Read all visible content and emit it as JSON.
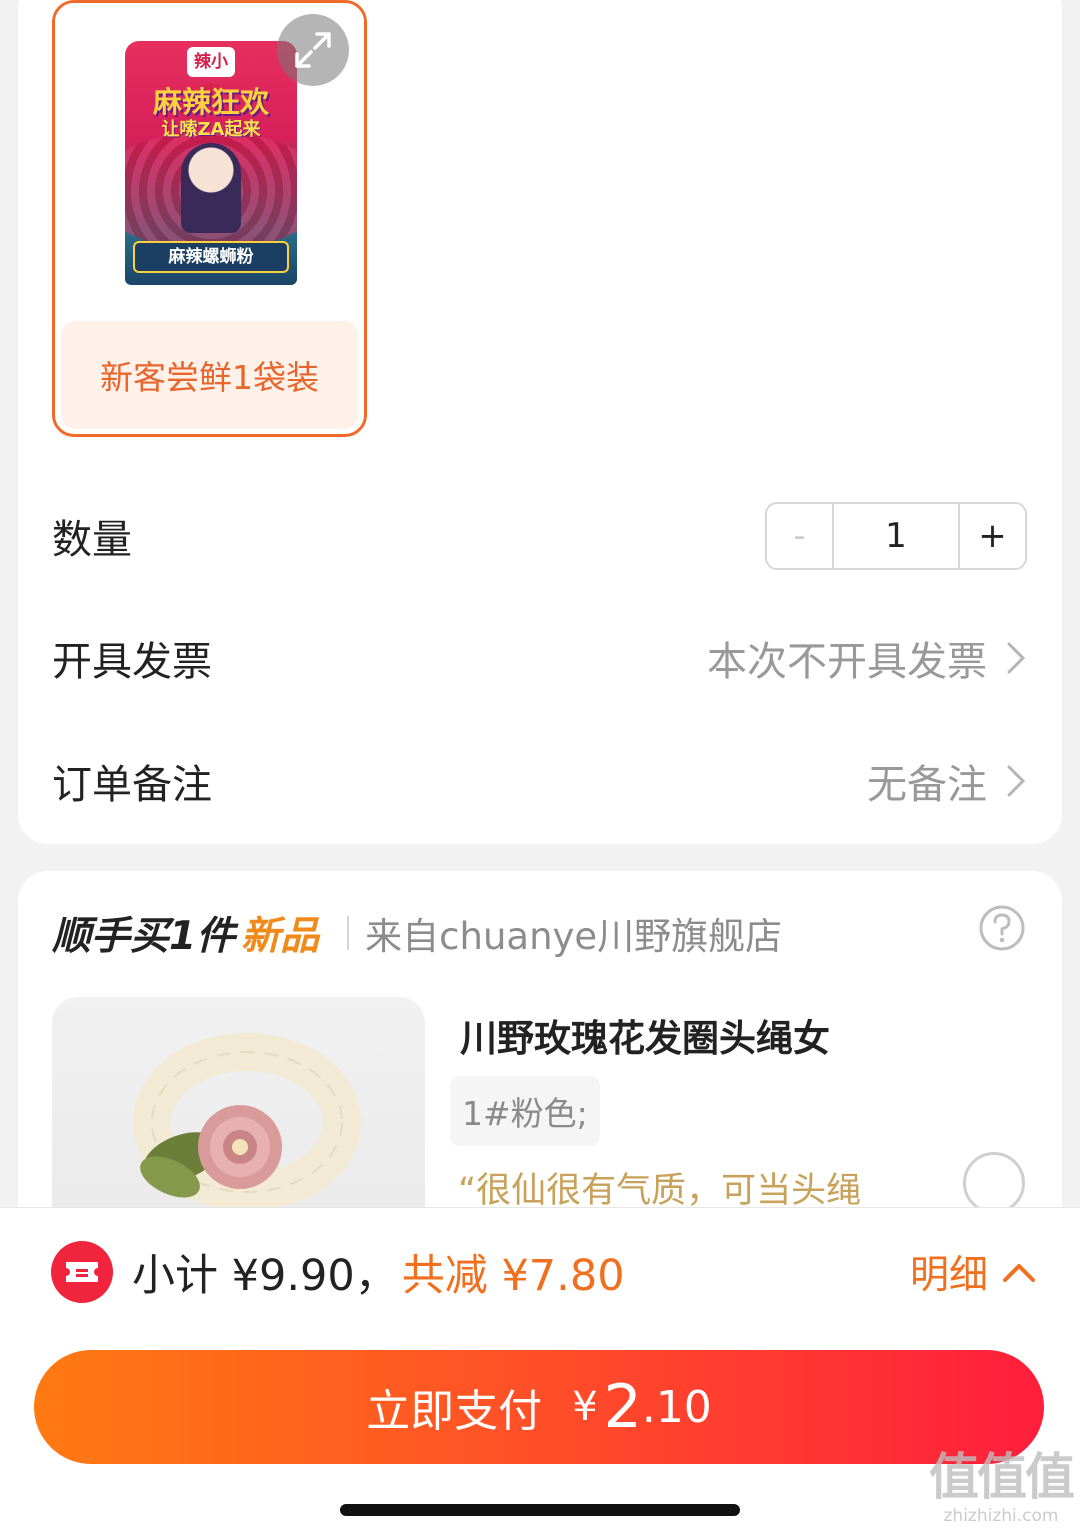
{
  "sku": {
    "label": "新客尝鲜1袋装",
    "package": {
      "logo_text": "辣小言",
      "headline": "麻辣狂欢",
      "subline": "让嗦ZA起来",
      "band_text": "麻辣螺蛳粉"
    }
  },
  "quantity": {
    "label": "数量",
    "minus": "-",
    "value": "1",
    "plus": "+"
  },
  "invoice": {
    "label": "开具发票",
    "value": "本次不开具发票"
  },
  "remark": {
    "label": "订单备注",
    "value": "无备注"
  },
  "addon": {
    "title": "顺手买1件",
    "badge": "新品",
    "shop": "来自chuanye川野旗舰店",
    "product": {
      "title": "川野玫瑰花发圈头绳女",
      "spec": "1#粉色;",
      "quote": "“很仙很有气质，可当头绳"
    }
  },
  "summary": {
    "subtotal_text": "小计 ¥9.90，",
    "savings_text": "共减 ¥7.80",
    "detail_label": "明细"
  },
  "pay": {
    "label": "立即支付",
    "currency": "¥",
    "amount_int": "2",
    "amount_dec": ".10"
  },
  "watermark": {
    "cn": "值值值",
    "en": "zhizhizhi.com"
  },
  "colors": {
    "accent": "#f07020",
    "pay_gradient_start": "#ff7a12",
    "pay_gradient_end": "#ff1e3c",
    "sku_border": "#f06a2a"
  }
}
